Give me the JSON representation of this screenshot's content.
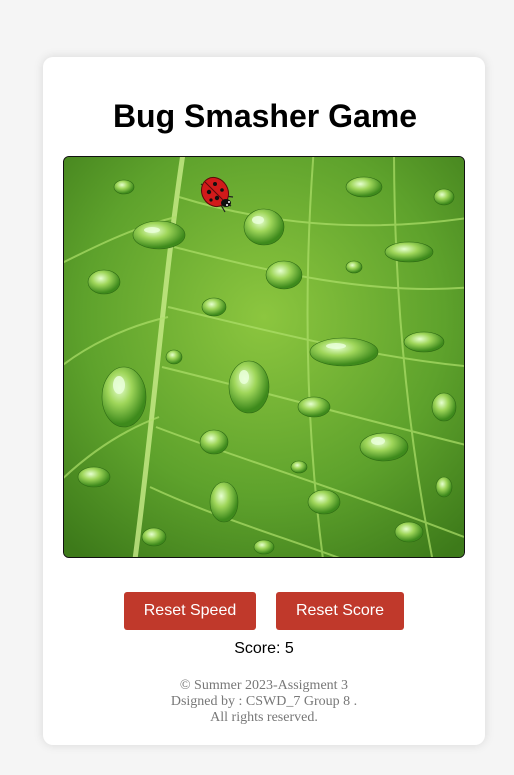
{
  "game": {
    "title": "Bug Smasher Game"
  },
  "controls": {
    "reset_speed_label": "Reset Speed",
    "reset_score_label": "Reset Score"
  },
  "status": {
    "score_text": "Score: 5",
    "score_value": 5
  },
  "footer": {
    "line1": "© Summer 2023-Assigment 3",
    "line2": "Dsigned by : CSWD_7 Group 8 .",
    "line3": "All rights reserved."
  },
  "sprites": {
    "bug_icon": "ladybug-icon",
    "background": "leaf-with-water-drops"
  },
  "colors": {
    "button": "#c0392b",
    "leaf": "#5e9e2a",
    "ladybug": "#d11a1a"
  }
}
